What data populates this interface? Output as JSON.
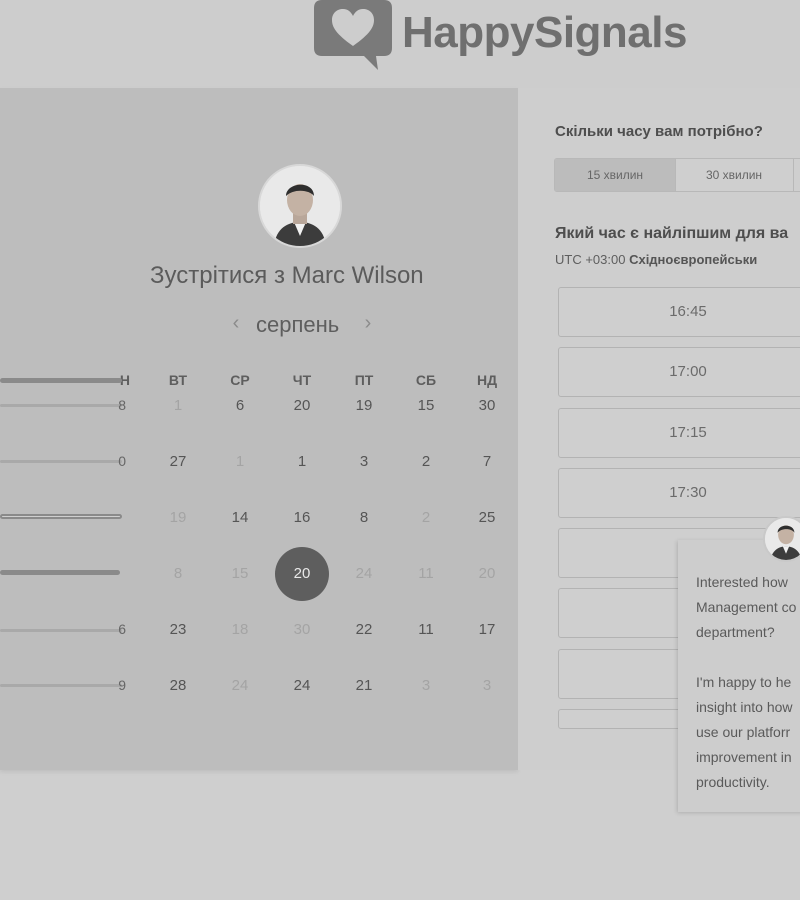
{
  "brand": {
    "name": "HappySignals"
  },
  "meeting": {
    "title": "Зустрітися з Marc Wilson",
    "month": "серпень",
    "prev_icon": "‹",
    "next_icon": "›"
  },
  "calendar": {
    "weekdays": [
      "Н",
      "ВТ",
      "СР",
      "ЧТ",
      "ПТ",
      "СБ",
      "НД"
    ],
    "rows": [
      {
        "first": "8",
        "days": [
          {
            "v": "1",
            "m": true
          },
          {
            "v": "6"
          },
          {
            "v": "20"
          },
          {
            "v": "19"
          },
          {
            "v": "15"
          },
          {
            "v": "30"
          }
        ]
      },
      {
        "first": "0",
        "days": [
          {
            "v": "27"
          },
          {
            "v": "1",
            "m": true
          },
          {
            "v": "1"
          },
          {
            "v": "3"
          },
          {
            "v": "2"
          },
          {
            "v": "7"
          }
        ]
      },
      {
        "first": "",
        "days": [
          {
            "v": "19",
            "m": true
          },
          {
            "v": "14"
          },
          {
            "v": "16"
          },
          {
            "v": "8"
          },
          {
            "v": "2",
            "m": true
          },
          {
            "v": "25"
          }
        ]
      },
      {
        "first": "",
        "days": [
          {
            "v": "8",
            "m": true
          },
          {
            "v": "15",
            "m": true
          },
          {
            "v": "20",
            "sel": true
          },
          {
            "v": "24",
            "m": true
          },
          {
            "v": "11",
            "m": true
          },
          {
            "v": "20",
            "m": true
          }
        ]
      },
      {
        "first": "6",
        "days": [
          {
            "v": "23"
          },
          {
            "v": "18",
            "m": true
          },
          {
            "v": "30",
            "m": true
          },
          {
            "v": "22"
          },
          {
            "v": "11"
          },
          {
            "v": "17"
          }
        ]
      },
      {
        "first": "9",
        "days": [
          {
            "v": "28"
          },
          {
            "v": "24",
            "m": true
          },
          {
            "v": "24"
          },
          {
            "v": "21"
          },
          {
            "v": "3",
            "m": true
          },
          {
            "v": "3",
            "m": true
          }
        ]
      }
    ]
  },
  "duration": {
    "question": "Скільки часу вам потрібно?",
    "options": [
      "15 хвилин",
      "30 хвилин"
    ],
    "selected": "15 хвилин"
  },
  "time": {
    "question": "Який час є найліпшим для ва",
    "tz_offset": "UTC +03:00",
    "tz_name": "Східноєвропейськи",
    "slots": [
      "16:45",
      "17:00",
      "17:15",
      "17:30"
    ]
  },
  "chat": {
    "lines": [
      "Interested how",
      "Management co",
      "department?",
      "",
      "I'm happy to he",
      "insight into how",
      "use our platforr",
      "improvement in",
      "productivity."
    ]
  },
  "colors": {
    "selected_day": "#5e5e5e",
    "page_bg": "#cfcfcf"
  }
}
